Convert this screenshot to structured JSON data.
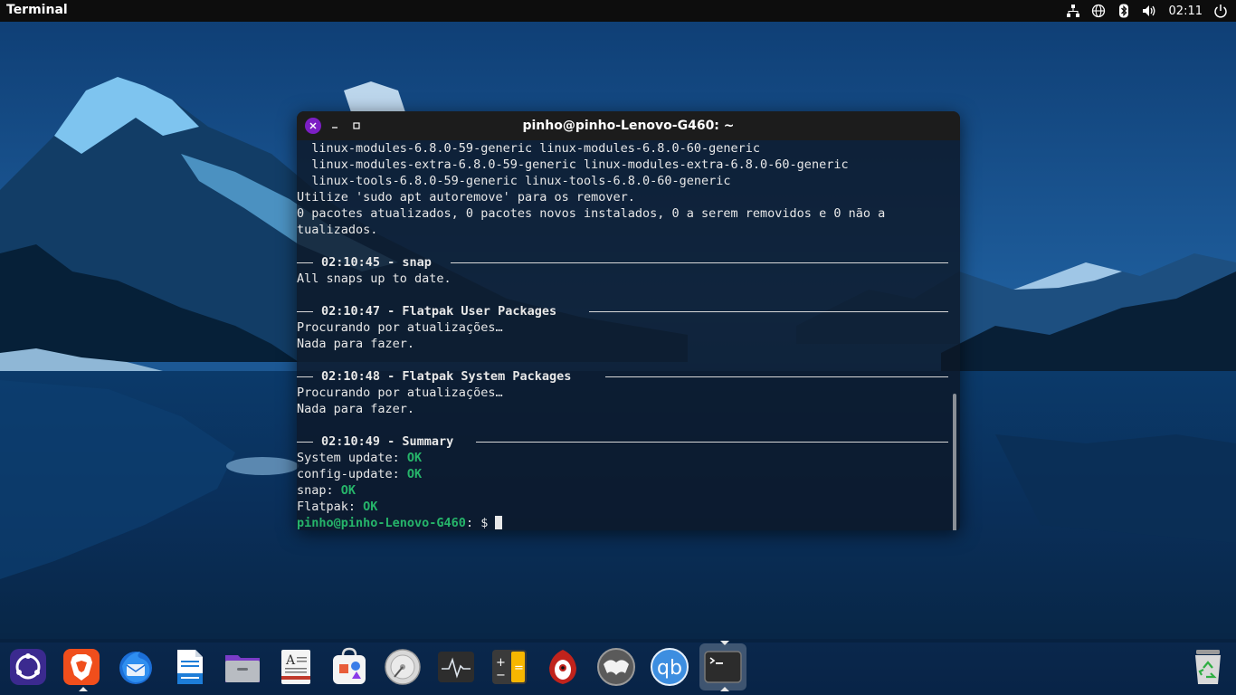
{
  "topbar": {
    "app_name": "Terminal",
    "clock": "02:11",
    "tray_icons": [
      "network-wired-icon",
      "globe-icon",
      "bluetooth-icon",
      "volume-icon",
      "power-icon"
    ]
  },
  "terminal": {
    "title": "pinho@pinho-Lenovo-G460: ~",
    "lines": [
      "  linux-modules-6.8.0-59-generic linux-modules-6.8.0-60-generic",
      "  linux-modules-extra-6.8.0-59-generic linux-modules-extra-6.8.0-60-generic",
      "  linux-tools-6.8.0-59-generic linux-tools-6.8.0-60-generic",
      "Utilize 'sudo apt autoremove' para os remover.",
      "0 pacotes atualizados, 0 pacotes novos instalados, 0 a serem removidos e 0 não a",
      "tualizados."
    ],
    "sections": [
      {
        "header": "02:10:45 - snap",
        "lines": [
          "All snaps up to date."
        ]
      },
      {
        "header": "02:10:47 - Flatpak User Packages",
        "lines": [
          "Procurando por atualizações…",
          "Nada para fazer."
        ]
      },
      {
        "header": "02:10:48 - Flatpak System Packages",
        "lines": [
          "Procurando por atualizações…",
          "Nada para fazer."
        ]
      },
      {
        "header": "02:10:49 - Summary",
        "lines": []
      }
    ],
    "summary": [
      {
        "label": "System update: ",
        "status": "OK"
      },
      {
        "label": "config-update: ",
        "status": "OK"
      },
      {
        "label": "snap: ",
        "status": "OK"
      },
      {
        "label": "Flatpak: ",
        "status": "OK"
      }
    ],
    "prompt": {
      "user_host": "pinho@pinho-Lenovo-G460",
      "suffix": ": $ "
    }
  },
  "dock": {
    "items": [
      "ubuntu-icon",
      "brave-icon",
      "thunderbird-icon",
      "writer-icon",
      "files-icon",
      "text-editor-icon",
      "app-center-icon",
      "disk-usage-icon",
      "system-monitor-icon",
      "calculator-icon",
      "hexchat-icon",
      "gimp-icon",
      "qbittorrent-icon",
      "terminal-icon",
      "trash-icon"
    ],
    "qb_label": "qb",
    "calc_plus": "+",
    "calc_minus": "−",
    "calc_eq": "="
  },
  "colors": {
    "ok_green": "#26b56a",
    "close_purple": "#7c1fc4",
    "topbar": "#0d0d0d"
  }
}
